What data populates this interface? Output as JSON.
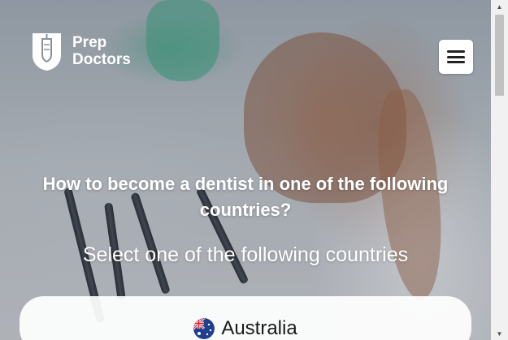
{
  "brand": {
    "line1": "Prep",
    "line2": "Doctors",
    "logo_icon": "tooth-shield-icon"
  },
  "menu": {
    "icon": "hamburger-menu-icon"
  },
  "hero": {
    "headline": "How to become a dentist in one of the following countries?",
    "subline": "Select one of the following countries"
  },
  "countries": [
    {
      "name": "Australia",
      "flag_icon": "australia-flag-icon"
    }
  ],
  "colors": {
    "text": "#ffffff",
    "card": "#ffffff",
    "menu_bg": "#ffffff"
  }
}
